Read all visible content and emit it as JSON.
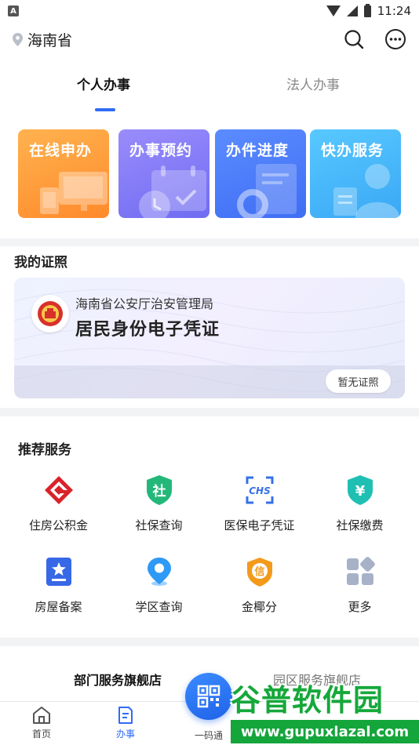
{
  "status_bar": {
    "time": "11:24",
    "badge": "A"
  },
  "header": {
    "location": "海南省"
  },
  "tabs": [
    {
      "label": "个人办事"
    },
    {
      "label": "法人办事"
    }
  ],
  "service_cards": [
    {
      "label": "在线申办",
      "color": "#ff9a3a"
    },
    {
      "label": "办事预约",
      "color": "#7f78f5"
    },
    {
      "label": "办件进度",
      "color": "#4a7cf7"
    },
    {
      "label": "快办服务",
      "color": "#47b7fa"
    }
  ],
  "license": {
    "title": "我的证照",
    "org": "海南省公安厅治安管理局",
    "name": "居民身份电子凭证",
    "button": "暂无证照"
  },
  "recommend": {
    "title": "推荐服务",
    "items": [
      {
        "label": "住房公积金",
        "icon": "housing-fund-icon"
      },
      {
        "label": "社保查询",
        "icon": "social-security-shield-icon",
        "glyph": "社"
      },
      {
        "label": "医保电子凭证",
        "icon": "chs-medical-insurance-icon",
        "glyph": "CHS"
      },
      {
        "label": "社保缴费",
        "icon": "yuan-shield-icon",
        "glyph": "¥"
      },
      {
        "label": "房屋备案",
        "icon": "house-record-icon"
      },
      {
        "label": "学区查询",
        "icon": "location-pin-icon"
      },
      {
        "label": "金椰分",
        "icon": "credit-badge-icon",
        "glyph": "信"
      },
      {
        "label": "更多",
        "icon": "grid-more-icon"
      }
    ]
  },
  "flagship": {
    "tabs": [
      {
        "label": "部门服务旗舰店"
      },
      {
        "label": "园区服务旗舰店"
      }
    ]
  },
  "bottom_nav": [
    {
      "label": "首页"
    },
    {
      "label": "办事"
    },
    {
      "label": "一码通"
    }
  ],
  "watermark": {
    "title": "谷普软件园",
    "url": "www.gupuxlazal.com"
  },
  "colors": {
    "accent": "#2f6bf5",
    "watermark_green": "#15a83a"
  }
}
